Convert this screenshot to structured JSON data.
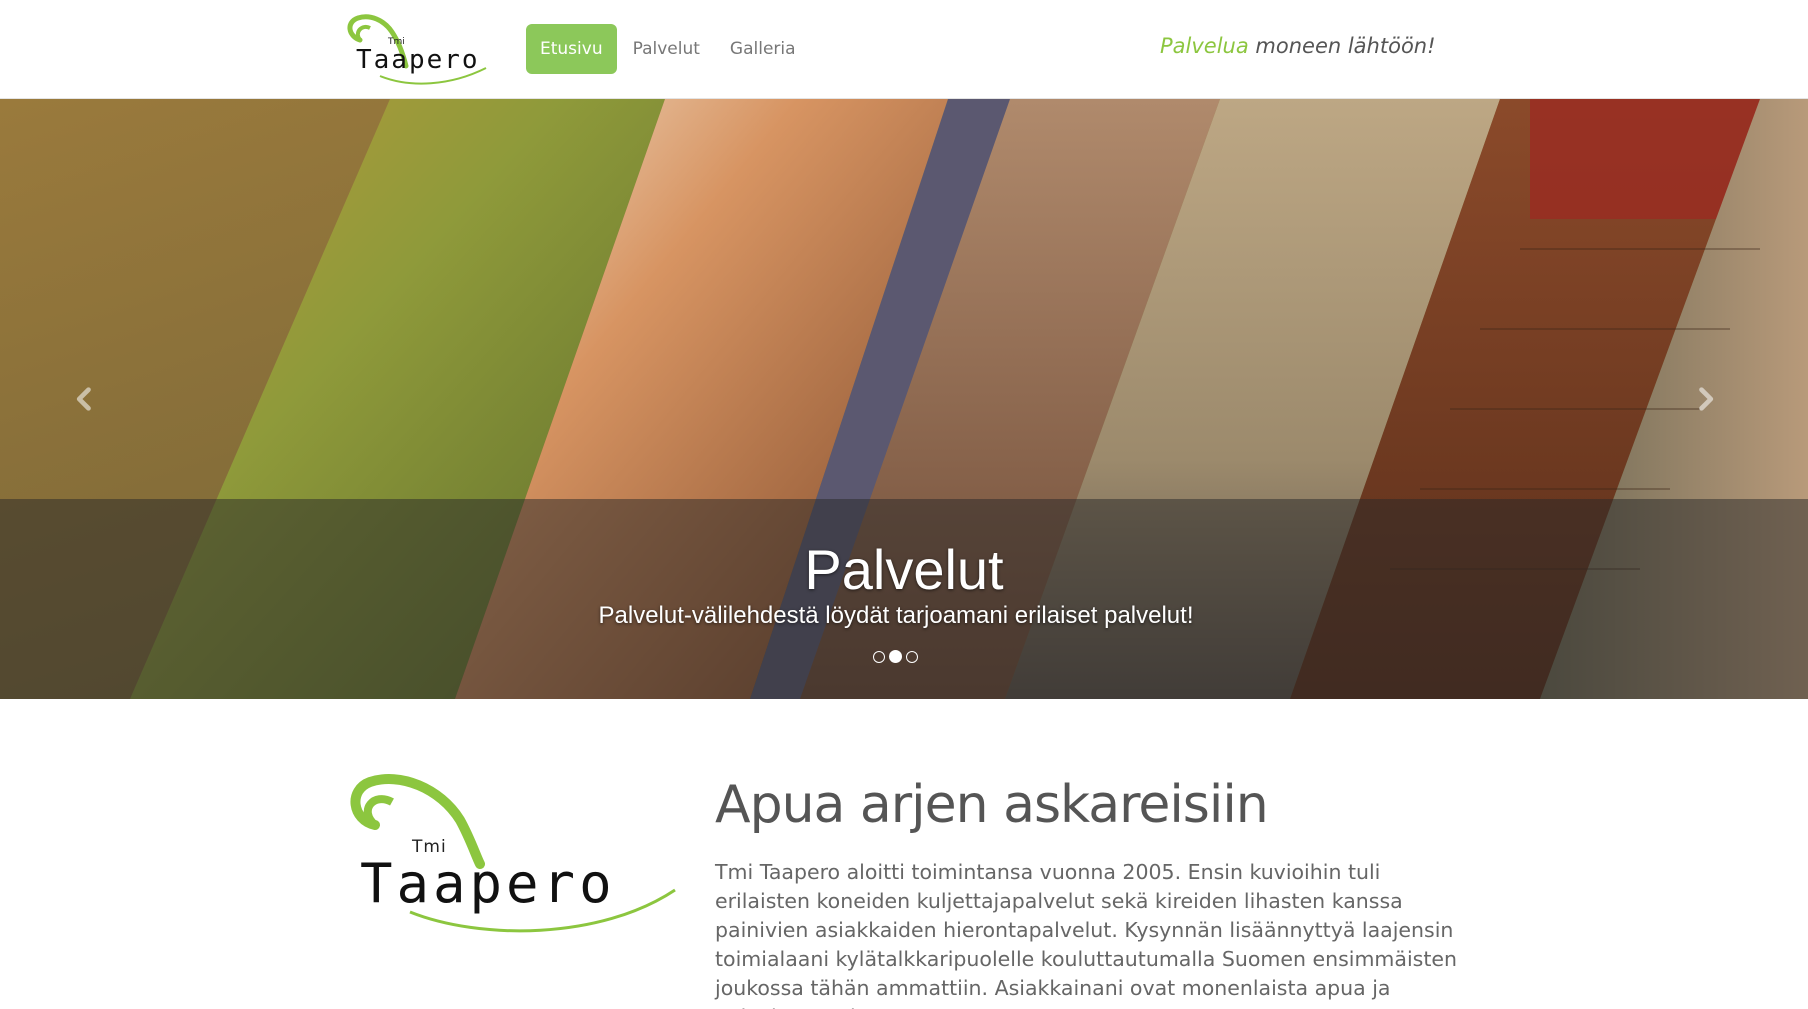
{
  "brand": {
    "prefix": "Tmi",
    "name": "Taapero",
    "green": "#8cc63f"
  },
  "nav": {
    "items": [
      {
        "label": "Etusivu",
        "active": true
      },
      {
        "label": "Palvelut",
        "active": false
      },
      {
        "label": "Galleria",
        "active": false
      }
    ],
    "slogan_accent": "Palvelua",
    "slogan_rest": " moneen lähtöön!"
  },
  "carousel": {
    "caption_title": "Palvelut",
    "caption_text": "Palvelut-välilehdestä löydät tarjoamani erilaiset palvelut!",
    "slide_count": 3,
    "active_slide": 1,
    "prev_icon": "chevron-left-icon",
    "next_icon": "chevron-right-icon"
  },
  "intro": {
    "heading": "Apua arjen askareisiin",
    "text": "Tmi Taapero aloitti toimintansa vuonna 2005. Ensin kuvioihin tuli erilaisten koneiden kuljettajapalvelut sekä kireiden lihasten kanssa painivien asiakkaiden hierontapalvelut. Kysynnän lisäännyttyä laajensin toimialaani kylätalkkaripuolelle kouluttautumalla Suomen ensimmäisten joukossa tähän ammattiin. Asiakkainani ovat monenlaista apua ja palvelua tarvitsevat"
  }
}
